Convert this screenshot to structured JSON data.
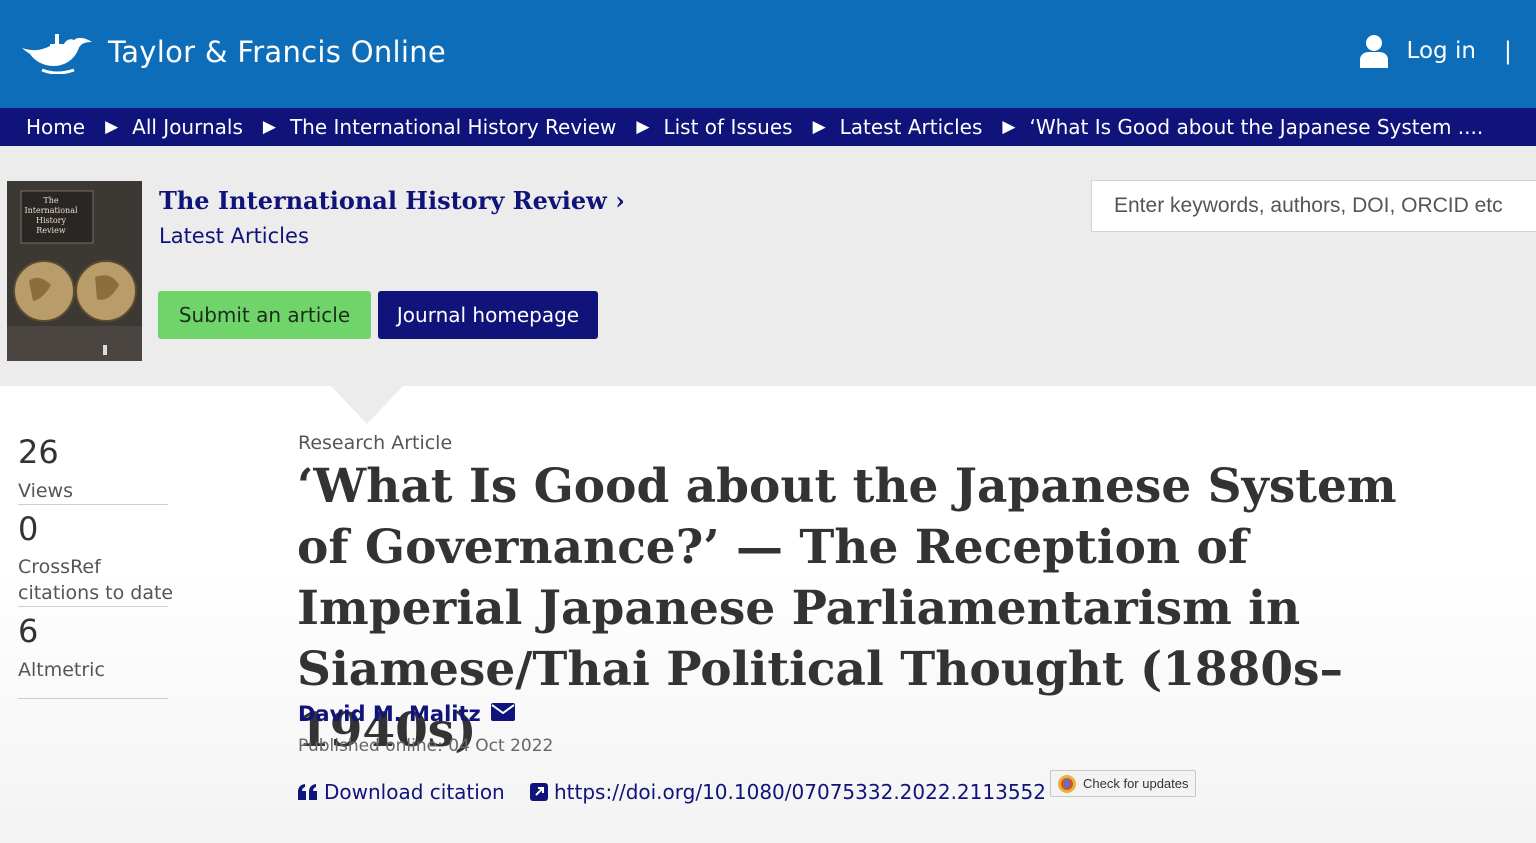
{
  "header": {
    "logo_text": "Taylor & Francis Online",
    "login_label": "Log in",
    "login_separator": "|"
  },
  "breadcrumbs": {
    "items": [
      "Home",
      "All Journals",
      "The International History Review",
      "List of Issues",
      "Latest Articles"
    ],
    "current": "‘What Is Good about the Japanese System ...."
  },
  "journal": {
    "title": "The International History Review ›",
    "subtitle": "Latest Articles",
    "submit_label": "Submit an article",
    "homepage_label": "Journal homepage",
    "cover_text": "The International History Review"
  },
  "search": {
    "placeholder": "Enter keywords, authors, DOI, ORCID etc"
  },
  "metrics": {
    "views_value": "26",
    "views_label": "Views",
    "crossref_value": "0",
    "crossref_label_1": "CrossRef",
    "crossref_label_2": "citations to date",
    "altmetric_value": "6",
    "altmetric_label": "Altmetric"
  },
  "article": {
    "type": "Research Article",
    "title": "‘What Is Good about the Japanese System of Governance?’ — The Reception of Imperial Japanese Parliamentarism in Siamese/Thai Political Thought (1880s–1940s)",
    "author": "David M. Malitz",
    "published": "Published online: 04 Oct 2022",
    "download_citation": "Download citation",
    "doi": "https://doi.org/10.1080/07075332.2022.2113552",
    "check_updates": "Check for updates"
  },
  "colors": {
    "brand_blue": "#0d6db8",
    "navy": "#10137a",
    "submit_green": "#6fd56b"
  }
}
